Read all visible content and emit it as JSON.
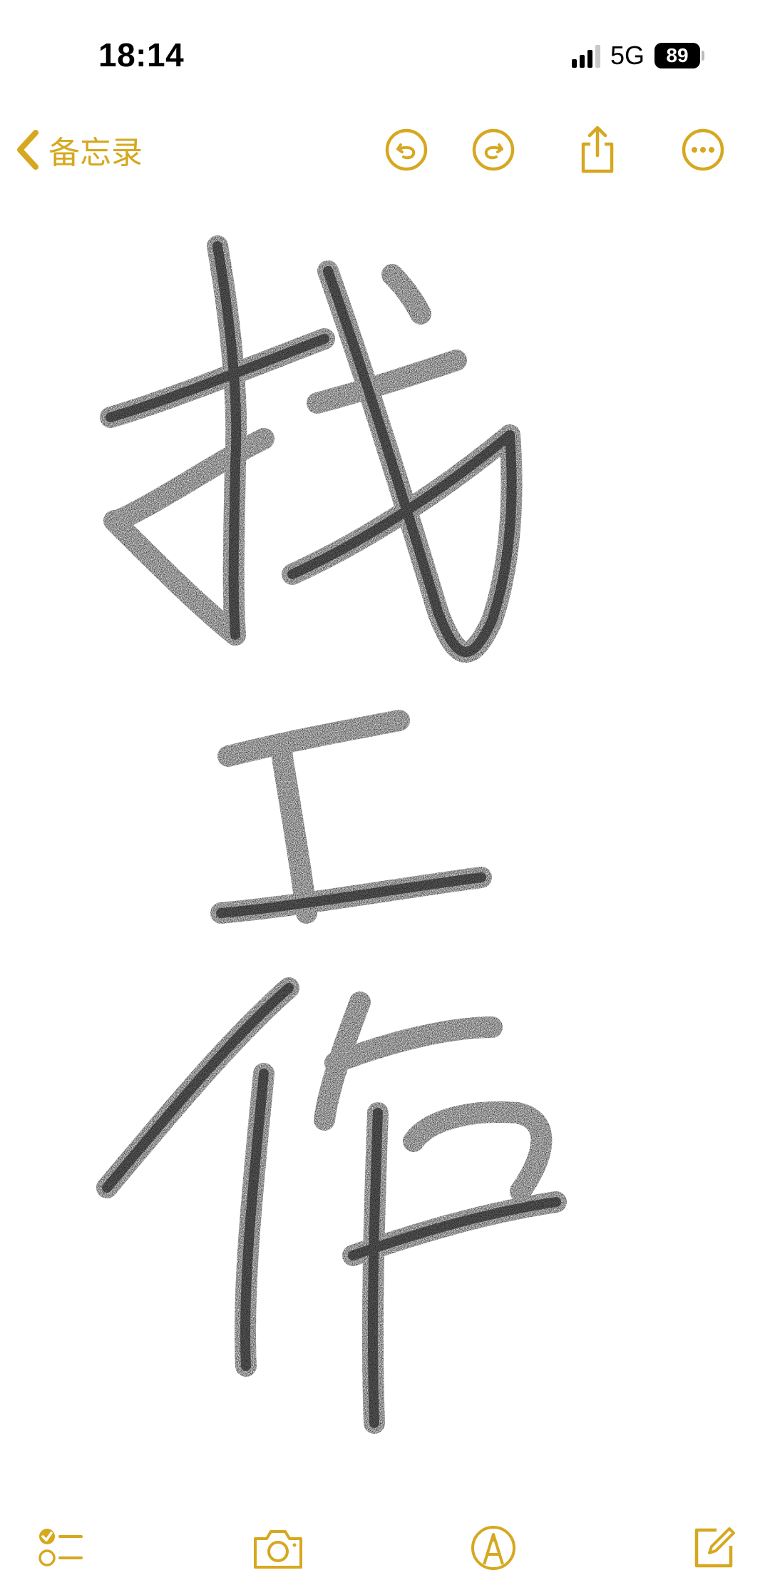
{
  "status_bar": {
    "time": "18:14",
    "network": "5G",
    "battery": "89"
  },
  "nav": {
    "back_label": "备忘录",
    "icons": [
      "undo-icon",
      "redo-icon",
      "share-icon",
      "more-icon"
    ]
  },
  "drawing": {
    "handwritten_text": "找工作"
  },
  "toolbar": {
    "icons": [
      "checklist-icon",
      "camera-icon",
      "markup-icon",
      "compose-icon"
    ]
  },
  "colors": {
    "accent": "#D6A820",
    "ink": "#111111",
    "background": "#FFFFFF"
  }
}
